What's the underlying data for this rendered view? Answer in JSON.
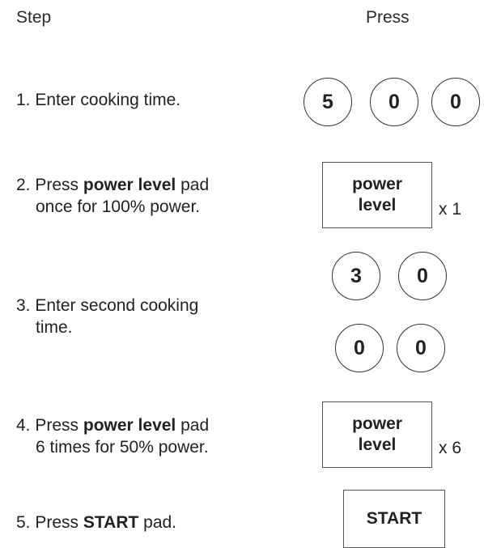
{
  "header": {
    "step_label": "Step",
    "press_label": "Press"
  },
  "steps": [
    {
      "number": "1.",
      "text": "Enter cooking time.",
      "keys": [
        "5",
        "0",
        "0"
      ]
    },
    {
      "number": "2.",
      "prefix": "Press ",
      "bold": "power level",
      "suffix": " pad",
      "line2": "once for 100% power.",
      "key_line1": "power",
      "key_line2": "level",
      "multiplier": "x 1"
    },
    {
      "number": "3.",
      "text": "Enter second cooking",
      "line2": "time.",
      "keys": [
        "3",
        "0",
        "0",
        "0"
      ]
    },
    {
      "number": "4.",
      "prefix": "Press ",
      "bold": "power level",
      "suffix": " pad",
      "line2": "6 times for 50% power.",
      "key_line1": "power",
      "key_line2": "level",
      "multiplier": "x 6"
    },
    {
      "number": "5.",
      "prefix": "Press ",
      "bold": "START",
      "suffix": " pad.",
      "key_label": "START"
    }
  ]
}
